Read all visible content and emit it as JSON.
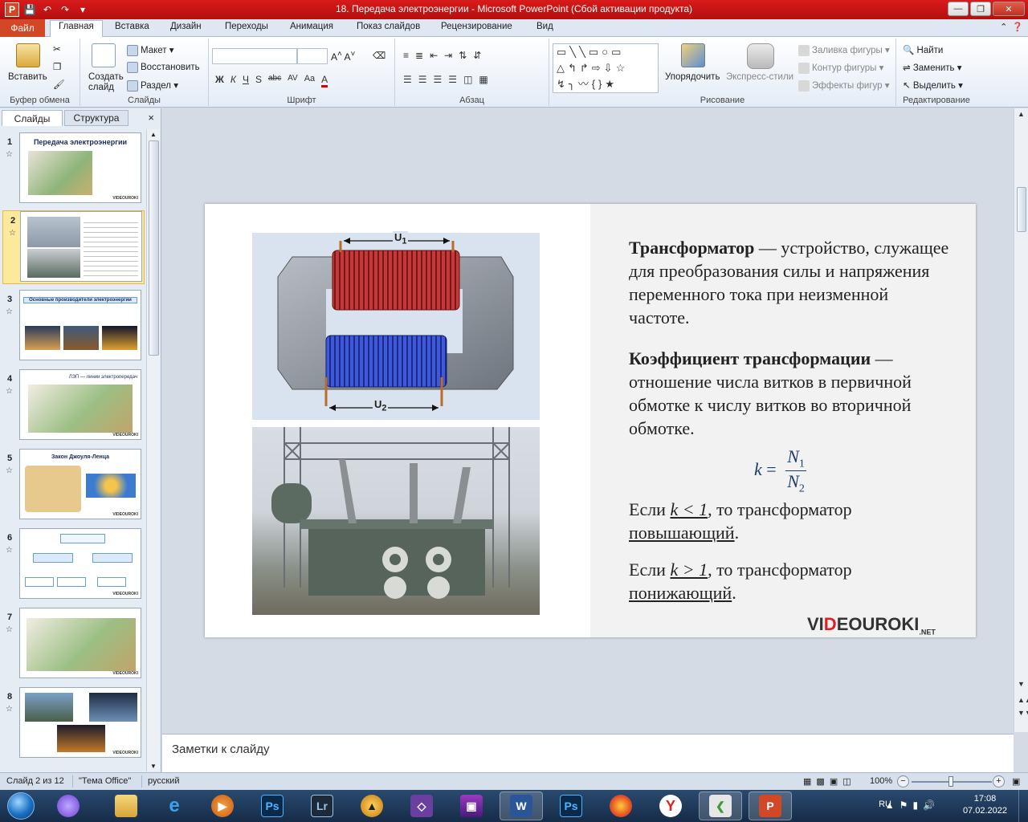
{
  "window": {
    "title": "18. Передача электроэнергии  -  Microsoft PowerPoint (Сбой активации продукта)"
  },
  "tabs": {
    "file": "Файл",
    "items": [
      "Главная",
      "Вставка",
      "Дизайн",
      "Переходы",
      "Анимация",
      "Показ слайдов",
      "Рецензирование",
      "Вид"
    ],
    "active": "Главная"
  },
  "ribbon": {
    "clipboard": {
      "label": "Буфер обмена",
      "paste": "Вставить"
    },
    "slides": {
      "label": "Слайды",
      "new_slide": "Создать слайд",
      "layout": "Макет",
      "reset": "Восстановить",
      "section": "Раздел"
    },
    "font": {
      "label": "Шрифт",
      "bold": "Ж",
      "italic": "К",
      "underline": "Ч",
      "shadow": "S",
      "strike": "abc",
      "spacing": "AV",
      "case": "Aa",
      "color": "A"
    },
    "paragraph": {
      "label": "Абзац"
    },
    "drawing": {
      "label": "Рисование",
      "arrange": "Упорядочить",
      "quick_styles": "Экспресс-стили",
      "fill": "Заливка фигуры",
      "outline": "Контур фигуры",
      "effects": "Эффекты фигур"
    },
    "editing": {
      "label": "Редактирование",
      "find": "Найти",
      "replace": "Заменить",
      "select": "Выделить"
    }
  },
  "left_panel": {
    "tab_slides": "Слайды",
    "tab_outline": "Структура",
    "close": "×",
    "thumbnails": [
      {
        "num": "1",
        "title": "Передача электроэнергии"
      },
      {
        "num": "2",
        "title": ""
      },
      {
        "num": "3",
        "title": "Основные производители электроэнергии"
      },
      {
        "num": "4",
        "title": "ЛЭП — линии электропередач"
      },
      {
        "num": "5",
        "title": "Закон  Джоуля-Ленца"
      },
      {
        "num": "6",
        "title": ""
      },
      {
        "num": "7",
        "title": ""
      },
      {
        "num": "8",
        "title": ""
      }
    ],
    "selected": "2",
    "thumb_logo": "VIDEOUROKI"
  },
  "slide": {
    "def_term": "Трансформатор",
    "def_text": " — устройство, служащее для преобразования силы и напряжения переменного тока при неизменной частоте.",
    "coef_term": "Коэффициент трансформации",
    "coef_text": " — отношение числа витков в первичной обмотке к числу витков во вторичной обмотке.",
    "formula": {
      "k": "k",
      "eq": "=",
      "num": "N",
      "num_sub": "1",
      "den": "N",
      "den_sub": "2"
    },
    "case1_prefix": "Если ",
    "case1_cond": "k < 1",
    "case1_mid": ", то трансформатор ",
    "case1_result": "повышающий",
    "case2_prefix": "Если ",
    "case2_cond": "k > 1",
    "case2_mid": ", то трансформатор ",
    "case2_result": "понижающий",
    "period": ".",
    "diagram": {
      "u1": "U",
      "u1_sub": "1",
      "u2": "U",
      "u2_sub": "2"
    },
    "logo": {
      "pre": "VI",
      "red": "D",
      "post": "EOUROKI",
      "suffix": ".NET"
    }
  },
  "notes": {
    "placeholder": "Заметки к слайду"
  },
  "status": {
    "slide_of": "Слайд 2 из 12",
    "theme": "\"Тема Office\"",
    "language": "русский",
    "zoom": "100%"
  },
  "taskbar": {
    "apps": [
      "Проводник",
      "Internet Explorer",
      "Media Player",
      "Photoshop",
      "Lightroom",
      "Archicad",
      "Visual Studio",
      "WinRAR",
      "Word",
      "Photoshop",
      "Firefox",
      "Yandex",
      "Network",
      "PowerPoint"
    ],
    "lang": "RU",
    "time": "17:08",
    "date": "07.02.2022"
  },
  "colors": {
    "titlebar": "#c81414",
    "file_tab": "#d24726",
    "selected_thumb": "#fde99c",
    "formula": "#1b3d6e",
    "logo_red": "#e02020"
  }
}
